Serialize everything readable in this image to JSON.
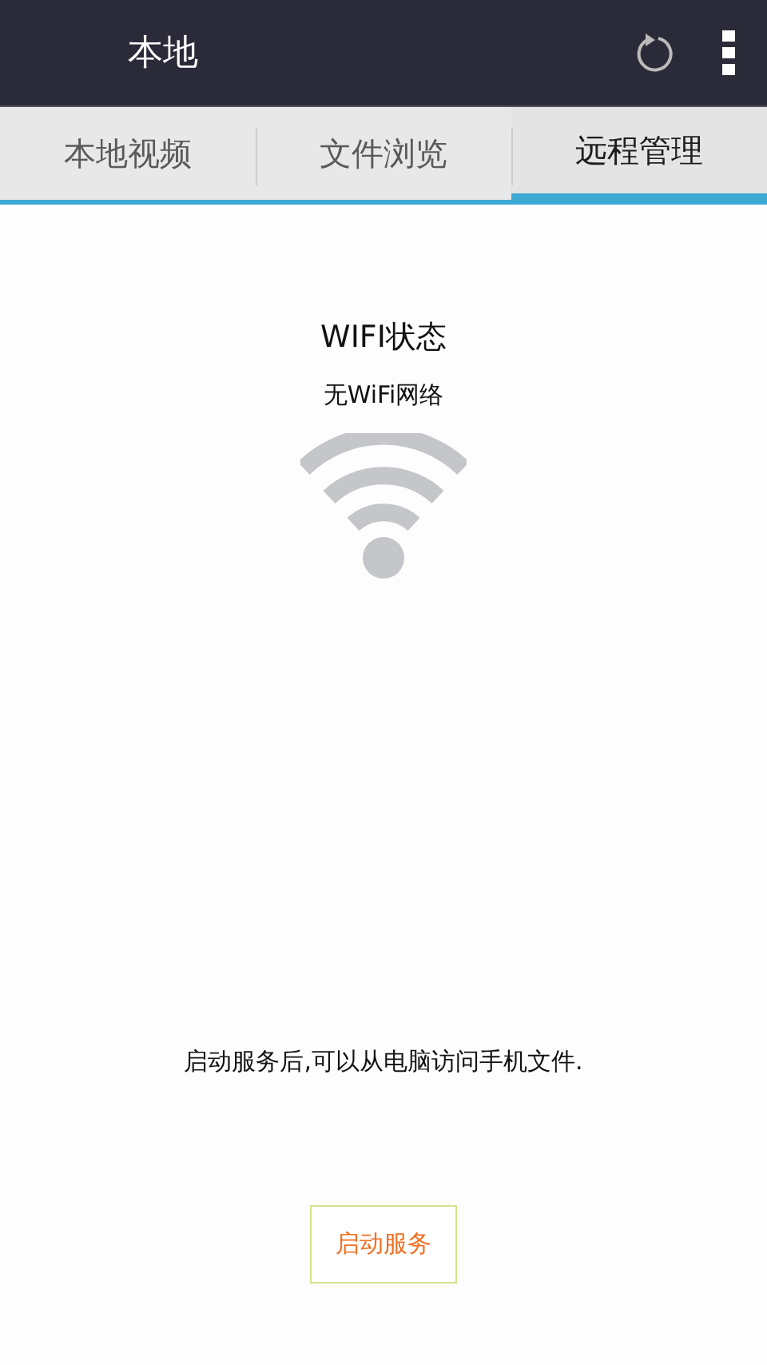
{
  "app_bar": {
    "title": "本地"
  },
  "tabs": [
    {
      "label": "本地视频",
      "selected": false
    },
    {
      "label": "文件浏览",
      "selected": false
    },
    {
      "label": "远程管理",
      "selected": true
    }
  ],
  "wifi": {
    "title": "WIFI状态",
    "status": "无WiFi网络"
  },
  "hint": "启动服务后,可以从电脑访问手机文件.",
  "start_button": "启动服务"
}
